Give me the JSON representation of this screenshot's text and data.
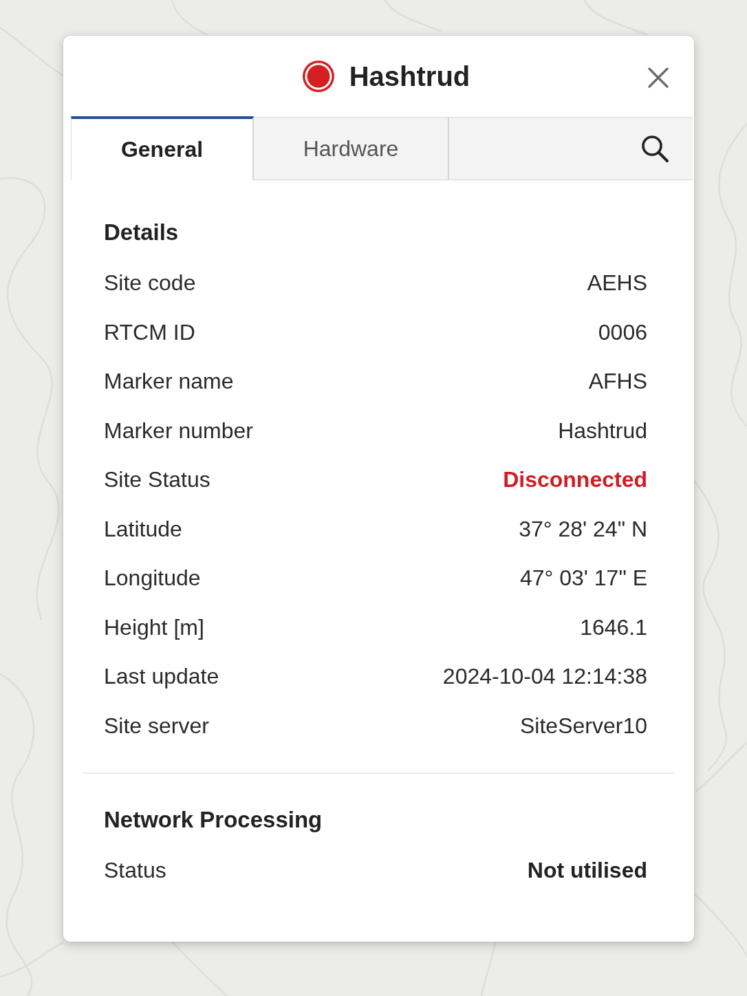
{
  "popup": {
    "title": "Hashtrud",
    "connected": false
  },
  "tabs": [
    {
      "label": "General",
      "selected": true
    },
    {
      "label": "Hardware",
      "selected": false
    }
  ],
  "sections": [
    {
      "heading": "Details",
      "rows": [
        {
          "label": "Site code",
          "value": "AEHS",
          "kind": "plain"
        },
        {
          "label": "RTCM ID",
          "value": "0006",
          "kind": "plain"
        },
        {
          "label": "Marker name",
          "value": "AFHS",
          "kind": "plain"
        },
        {
          "label": "Marker number",
          "value": "Hashtrud",
          "kind": "plain"
        },
        {
          "label": "Site Status",
          "value": "Disconnected",
          "kind": "alert"
        },
        {
          "label": "Latitude",
          "value": "37° 28' 24\" N",
          "kind": "plain"
        },
        {
          "label": "Longitude",
          "value": "47° 03' 17\" E",
          "kind": "plain"
        },
        {
          "label": "Height [m]",
          "value": "1646.1",
          "kind": "plain"
        },
        {
          "label": "Last update",
          "value": "2024-10-04 12:14:38",
          "kind": "plain"
        },
        {
          "label": "Site server",
          "value": "SiteServer10",
          "kind": "plain"
        }
      ]
    },
    {
      "heading": "Network Processing",
      "rows": [
        {
          "label": "Status",
          "value": "Not utilised",
          "kind": "strong"
        }
      ]
    }
  ]
}
